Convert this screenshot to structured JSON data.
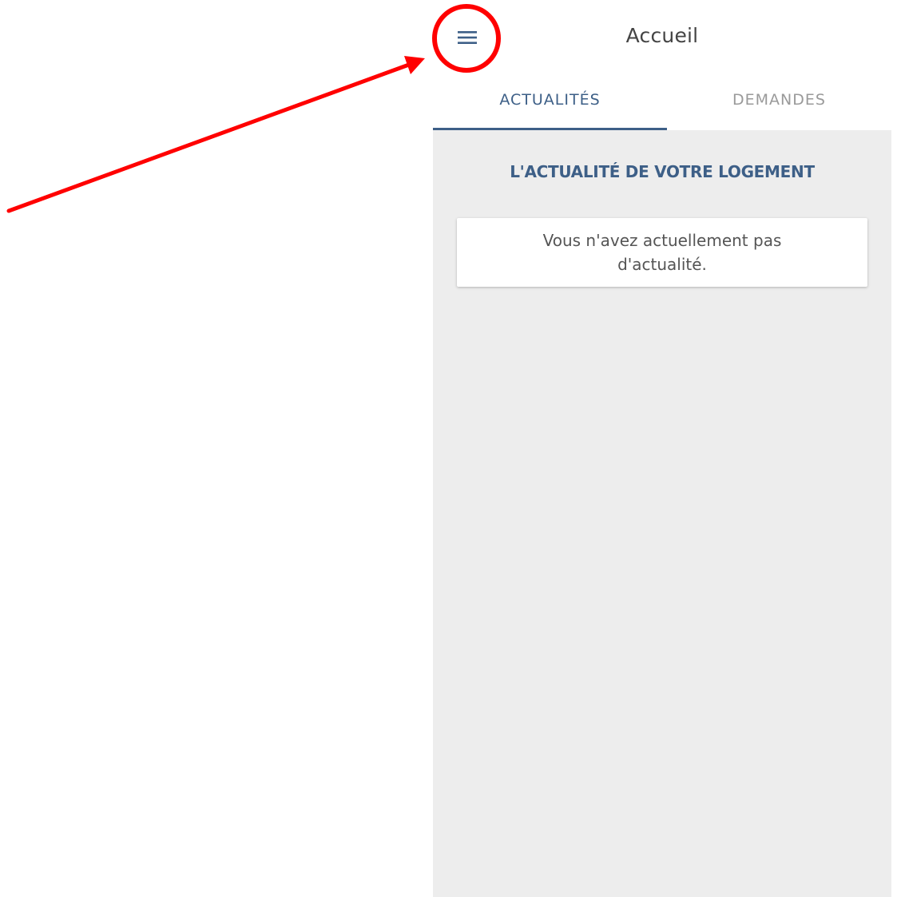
{
  "appbar": {
    "title": "Accueil",
    "menu_icon": "hamburger-menu-icon"
  },
  "tabs": [
    {
      "label": "ACTUALITÉS",
      "active": true
    },
    {
      "label": "DEMANDES",
      "active": false
    }
  ],
  "content": {
    "section_title": "L'ACTUALITÉ DE VOTRE LOGEMENT",
    "empty_message": "Vous n'avez actuellement pas d'actualité."
  },
  "colors": {
    "accent": "#3d5f87",
    "background": "#ededed",
    "annotation": "#ff0000"
  }
}
